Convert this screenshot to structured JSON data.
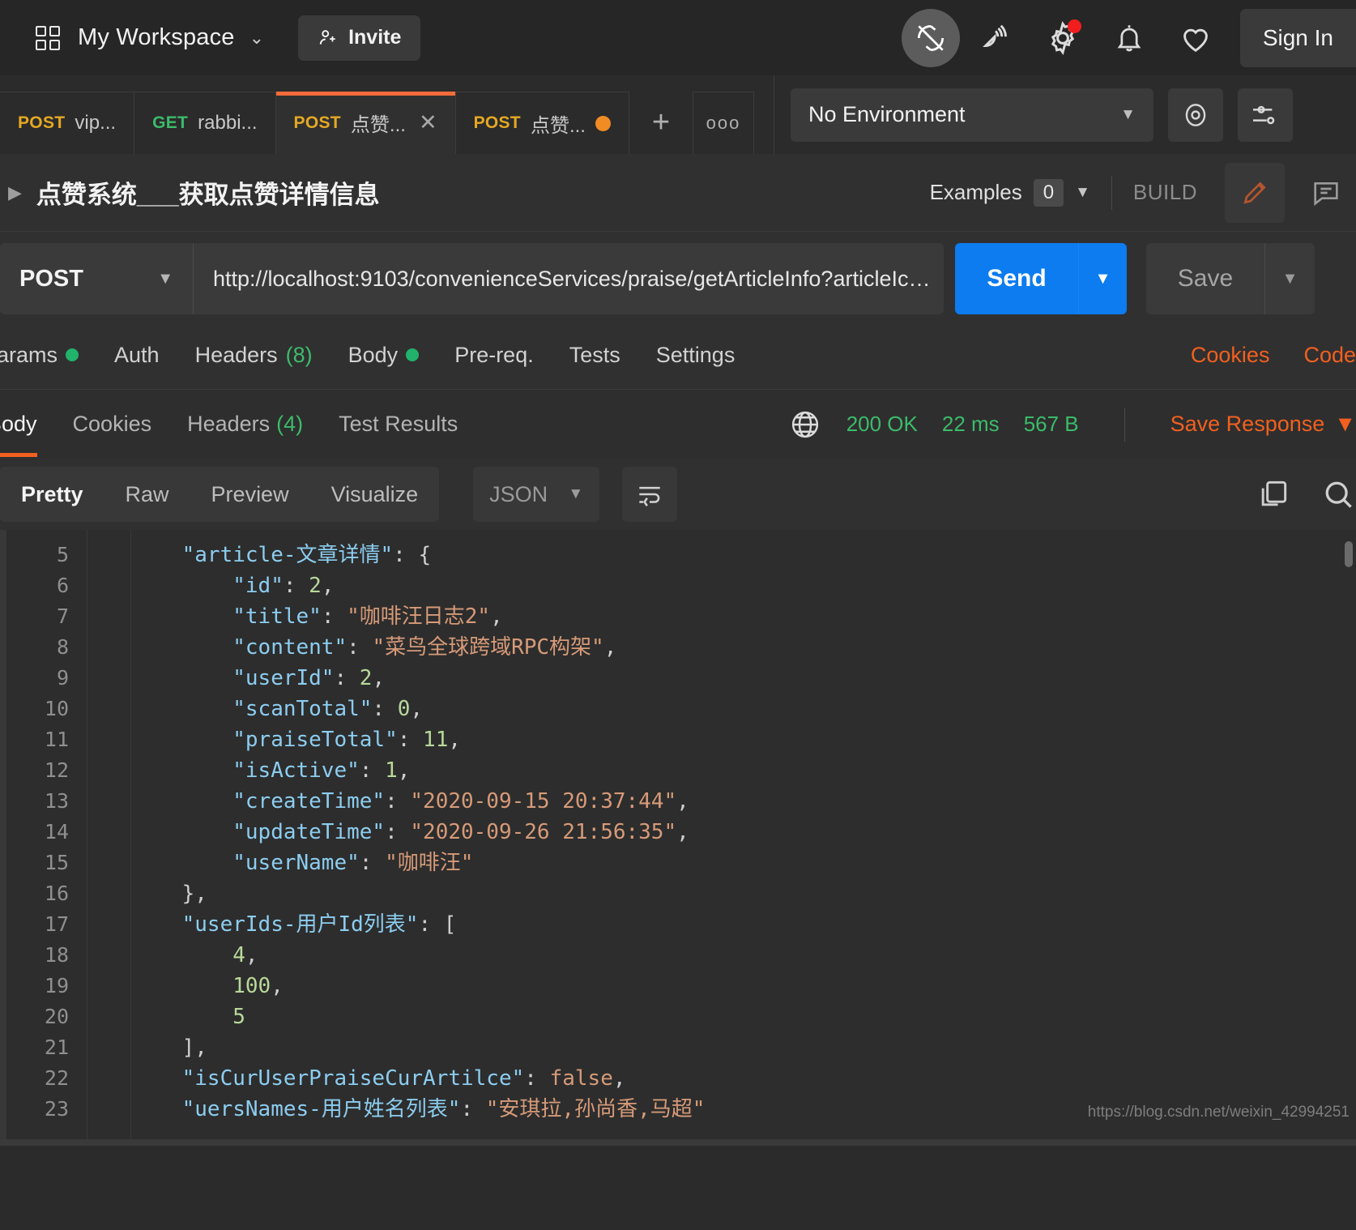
{
  "topbar": {
    "workspace_name": "My Workspace",
    "invite_label": "Invite",
    "signin_label": "Sign In",
    "icons": [
      "grid-icon",
      "chevron-down-icon",
      "person-add-icon",
      "sync-off-icon",
      "satellite-icon",
      "gear-icon",
      "bell-icon",
      "heart-icon"
    ]
  },
  "tabs": [
    {
      "verb": "POST",
      "verb_class": "post",
      "name": "vip...",
      "state": ""
    },
    {
      "verb": "GET",
      "verb_class": "get",
      "name": "rabbi...",
      "state": ""
    },
    {
      "verb": "POST",
      "verb_class": "post",
      "name": "点赞...",
      "state": "active"
    },
    {
      "verb": "POST",
      "verb_class": "post",
      "name": "点赞...",
      "state": "unsaved"
    }
  ],
  "tabbar": {
    "add_label": "+",
    "more_label": "ooo"
  },
  "environment": {
    "selected": "No Environment",
    "caret": "▼"
  },
  "request_title": {
    "caret": "▶",
    "name": "点赞系统___获取点赞详情信息",
    "examples_label": "Examples",
    "examples_count": "0",
    "examples_caret": "▼",
    "build_label": "BUILD"
  },
  "url_bar": {
    "method": "POST",
    "method_caret": "▼",
    "url": "http://localhost:9103/convenienceServices/praise/getArticleInfo?articleIc…",
    "send_label": "Send",
    "send_caret": "▼",
    "save_label": "Save",
    "save_caret": "▼"
  },
  "request_tabs": [
    {
      "label": "Params",
      "dot": true,
      "count": ""
    },
    {
      "label": "Auth",
      "dot": false,
      "count": ""
    },
    {
      "label": "Headers",
      "dot": false,
      "count": "(8)"
    },
    {
      "label": "Body",
      "dot": true,
      "count": ""
    },
    {
      "label": "Pre-req.",
      "dot": false,
      "count": ""
    },
    {
      "label": "Tests",
      "dot": false,
      "count": ""
    },
    {
      "label": "Settings",
      "dot": false,
      "count": ""
    }
  ],
  "request_links": [
    "Cookies",
    "Code"
  ],
  "response_tabs": [
    {
      "label": "Body",
      "count": "",
      "active": true
    },
    {
      "label": "Cookies",
      "count": "",
      "active": false
    },
    {
      "label": "Headers",
      "count": "(4)",
      "active": false
    },
    {
      "label": "Test Results",
      "count": "",
      "active": false
    }
  ],
  "response_status": {
    "globe_icon": "globe-icon",
    "status": "200 OK",
    "time": "22 ms",
    "size": "567 B",
    "save_response": "Save Response",
    "save_response_caret": "▼"
  },
  "format_bar": {
    "modes": [
      "Pretty",
      "Raw",
      "Preview",
      "Visualize"
    ],
    "active_mode": "Pretty",
    "language": "JSON",
    "language_caret": "▼",
    "wrap_icon": "word-wrap-icon",
    "copy_icon": "copy-icon",
    "search_icon": "search-icon"
  },
  "code": {
    "first_line_number": 5,
    "lines": [
      {
        "n": 5,
        "tokens": [
          {
            "t": "    ",
            "c": "p"
          },
          {
            "t": "\"article-文章详情\"",
            "c": "k"
          },
          {
            "t": ": {",
            "c": "p"
          }
        ]
      },
      {
        "n": 6,
        "tokens": [
          {
            "t": "        ",
            "c": "p"
          },
          {
            "t": "\"id\"",
            "c": "k"
          },
          {
            "t": ": ",
            "c": "p"
          },
          {
            "t": "2",
            "c": "n"
          },
          {
            "t": ",",
            "c": "p"
          }
        ]
      },
      {
        "n": 7,
        "tokens": [
          {
            "t": "        ",
            "c": "p"
          },
          {
            "t": "\"title\"",
            "c": "k"
          },
          {
            "t": ": ",
            "c": "p"
          },
          {
            "t": "\"咖啡汪日志2\"",
            "c": "s"
          },
          {
            "t": ",",
            "c": "p"
          }
        ]
      },
      {
        "n": 8,
        "tokens": [
          {
            "t": "        ",
            "c": "p"
          },
          {
            "t": "\"content\"",
            "c": "k"
          },
          {
            "t": ": ",
            "c": "p"
          },
          {
            "t": "\"菜鸟全球跨域RPC构架\"",
            "c": "s"
          },
          {
            "t": ",",
            "c": "p"
          }
        ]
      },
      {
        "n": 9,
        "tokens": [
          {
            "t": "        ",
            "c": "p"
          },
          {
            "t": "\"userId\"",
            "c": "k"
          },
          {
            "t": ": ",
            "c": "p"
          },
          {
            "t": "2",
            "c": "n"
          },
          {
            "t": ",",
            "c": "p"
          }
        ]
      },
      {
        "n": 10,
        "tokens": [
          {
            "t": "        ",
            "c": "p"
          },
          {
            "t": "\"scanTotal\"",
            "c": "k"
          },
          {
            "t": ": ",
            "c": "p"
          },
          {
            "t": "0",
            "c": "n"
          },
          {
            "t": ",",
            "c": "p"
          }
        ]
      },
      {
        "n": 11,
        "tokens": [
          {
            "t": "        ",
            "c": "p"
          },
          {
            "t": "\"praiseTotal\"",
            "c": "k"
          },
          {
            "t": ": ",
            "c": "p"
          },
          {
            "t": "11",
            "c": "n"
          },
          {
            "t": ",",
            "c": "p"
          }
        ]
      },
      {
        "n": 12,
        "tokens": [
          {
            "t": "        ",
            "c": "p"
          },
          {
            "t": "\"isActive\"",
            "c": "k"
          },
          {
            "t": ": ",
            "c": "p"
          },
          {
            "t": "1",
            "c": "n"
          },
          {
            "t": ",",
            "c": "p"
          }
        ]
      },
      {
        "n": 13,
        "tokens": [
          {
            "t": "        ",
            "c": "p"
          },
          {
            "t": "\"createTime\"",
            "c": "k"
          },
          {
            "t": ": ",
            "c": "p"
          },
          {
            "t": "\"2020-09-15 20:37:44\"",
            "c": "s"
          },
          {
            "t": ",",
            "c": "p"
          }
        ]
      },
      {
        "n": 14,
        "tokens": [
          {
            "t": "        ",
            "c": "p"
          },
          {
            "t": "\"updateTime\"",
            "c": "k"
          },
          {
            "t": ": ",
            "c": "p"
          },
          {
            "t": "\"2020-09-26 21:56:35\"",
            "c": "s"
          },
          {
            "t": ",",
            "c": "p"
          }
        ]
      },
      {
        "n": 15,
        "tokens": [
          {
            "t": "        ",
            "c": "p"
          },
          {
            "t": "\"userName\"",
            "c": "k"
          },
          {
            "t": ": ",
            "c": "p"
          },
          {
            "t": "\"咖啡汪\"",
            "c": "s"
          }
        ]
      },
      {
        "n": 16,
        "tokens": [
          {
            "t": "    ",
            "c": "p"
          },
          {
            "t": "},",
            "c": "p"
          }
        ]
      },
      {
        "n": 17,
        "tokens": [
          {
            "t": "    ",
            "c": "p"
          },
          {
            "t": "\"userIds-用户Id列表\"",
            "c": "k"
          },
          {
            "t": ": [",
            "c": "p"
          }
        ]
      },
      {
        "n": 18,
        "tokens": [
          {
            "t": "        ",
            "c": "p"
          },
          {
            "t": "4",
            "c": "n"
          },
          {
            "t": ",",
            "c": "p"
          }
        ]
      },
      {
        "n": 19,
        "tokens": [
          {
            "t": "        ",
            "c": "p"
          },
          {
            "t": "100",
            "c": "n"
          },
          {
            "t": ",",
            "c": "p"
          }
        ]
      },
      {
        "n": 20,
        "tokens": [
          {
            "t": "        ",
            "c": "p"
          },
          {
            "t": "5",
            "c": "n"
          }
        ]
      },
      {
        "n": 21,
        "tokens": [
          {
            "t": "    ",
            "c": "p"
          },
          {
            "t": "],",
            "c": "p"
          }
        ]
      },
      {
        "n": 22,
        "tokens": [
          {
            "t": "    ",
            "c": "p"
          },
          {
            "t": "\"isCurUserPraiseCurArtilce\"",
            "c": "k"
          },
          {
            "t": ": ",
            "c": "p"
          },
          {
            "t": "false",
            "c": "b"
          },
          {
            "t": ",",
            "c": "p"
          }
        ]
      },
      {
        "n": 23,
        "tokens": [
          {
            "t": "    ",
            "c": "p"
          },
          {
            "t": "\"uersNames-用户姓名列表\"",
            "c": "k"
          },
          {
            "t": ": ",
            "c": "p"
          },
          {
            "t": "\"安琪拉,孙尚香,马超\"",
            "c": "s"
          }
        ]
      }
    ]
  },
  "watermark": "https://blog.csdn.net/weixin_42994251",
  "colors": {
    "accent_orange": "#f2601f",
    "send_blue": "#0c7cf0",
    "green": "#3cbb6a",
    "post_yellow": "#e5a823",
    "unsaved_orange": "#f08c23",
    "red_badge": "#f21d1d"
  }
}
